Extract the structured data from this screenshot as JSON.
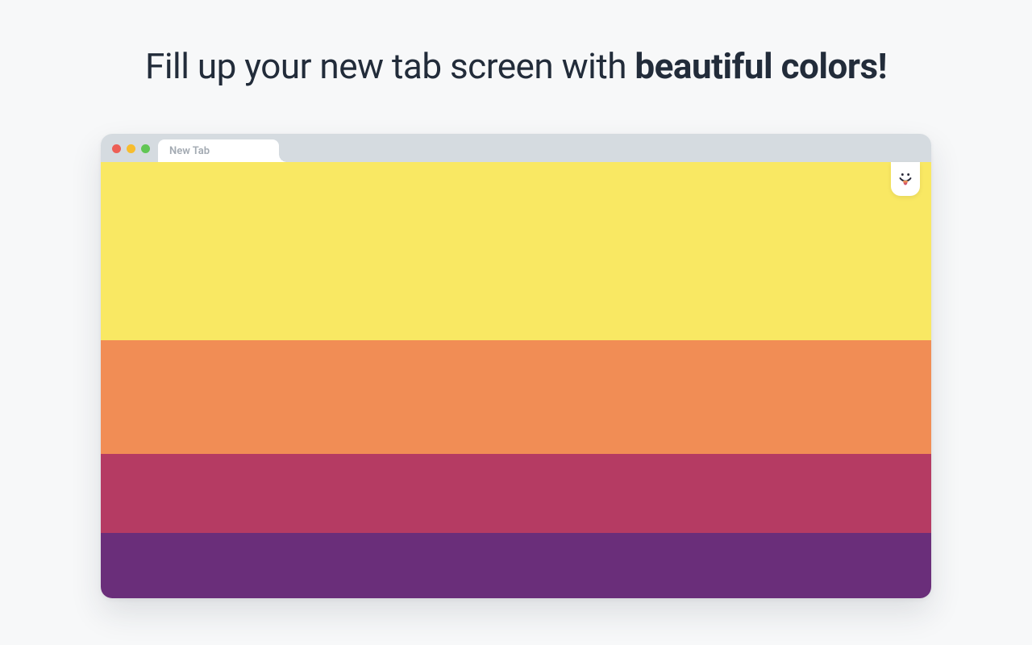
{
  "headline": {
    "prefix": "Fill up your new tab screen with ",
    "bold": "beautiful colors!"
  },
  "browser": {
    "tab_label": "New Tab",
    "traffic_light_colors": {
      "close": "#ed5f56",
      "minimize": "#f7bd2e",
      "zoom": "#61c654"
    }
  },
  "palette": {
    "stripes": [
      "#f9e863",
      "#f18d55",
      "#b53b63",
      "#6a2e7a"
    ]
  },
  "badge": {
    "icon_name": "face-tongue-icon"
  }
}
